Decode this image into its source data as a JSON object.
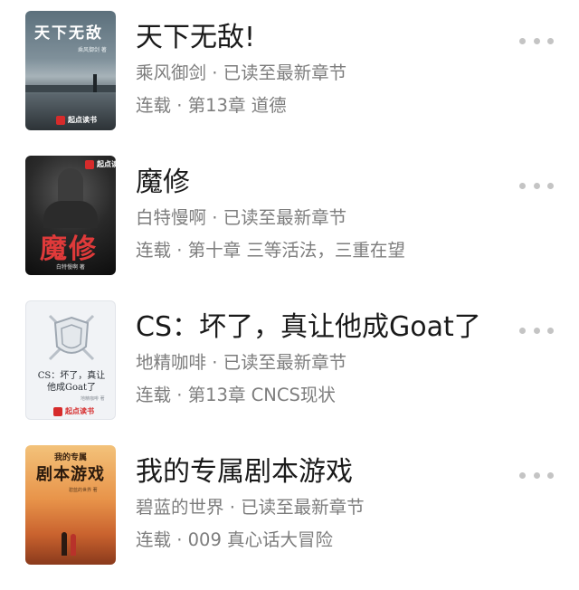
{
  "books": [
    {
      "title": "天下无敌!",
      "author": "乘风御剑",
      "read_status": "已读至最新章节",
      "serial_status": "连载",
      "latest_chapter": "第13章 道德",
      "cover": {
        "title": "天下无敌",
        "author": "乘风御剑 著",
        "publisher": "起点读书"
      }
    },
    {
      "title": "魔修",
      "author": "白特慢啊",
      "read_status": "已读至最新章节",
      "serial_status": "连载",
      "latest_chapter": "第十章 三等活法，三重在望",
      "cover": {
        "title": "魔修",
        "author": "白特慢啊 著",
        "publisher": "起点读书"
      }
    },
    {
      "title": "CS：坏了，真让他成Goat了",
      "author": "地精咖啡",
      "read_status": "已读至最新章节",
      "serial_status": "连载",
      "latest_chapter": "第13章 CNCS现状",
      "cover": {
        "title_line1": "CS：坏了，真让",
        "title_line2": "他成Goat了",
        "author": "地精咖啡 著",
        "publisher": "起点读书"
      }
    },
    {
      "title": "我的专属剧本游戏",
      "author": "碧蓝的世界",
      "read_status": "已读至最新章节",
      "serial_status": "连载",
      "latest_chapter": "009 真心话大冒险",
      "cover": {
        "subtitle": "我的专属",
        "title": "剧本游戏",
        "author": "碧蓝的世界 著"
      }
    }
  ],
  "separator": " · ",
  "colors": {
    "title": "#1a1a1a",
    "meta": "#7d7d7d",
    "more_dots": "#c4c4c4",
    "brand_red": "#d62b2b"
  }
}
